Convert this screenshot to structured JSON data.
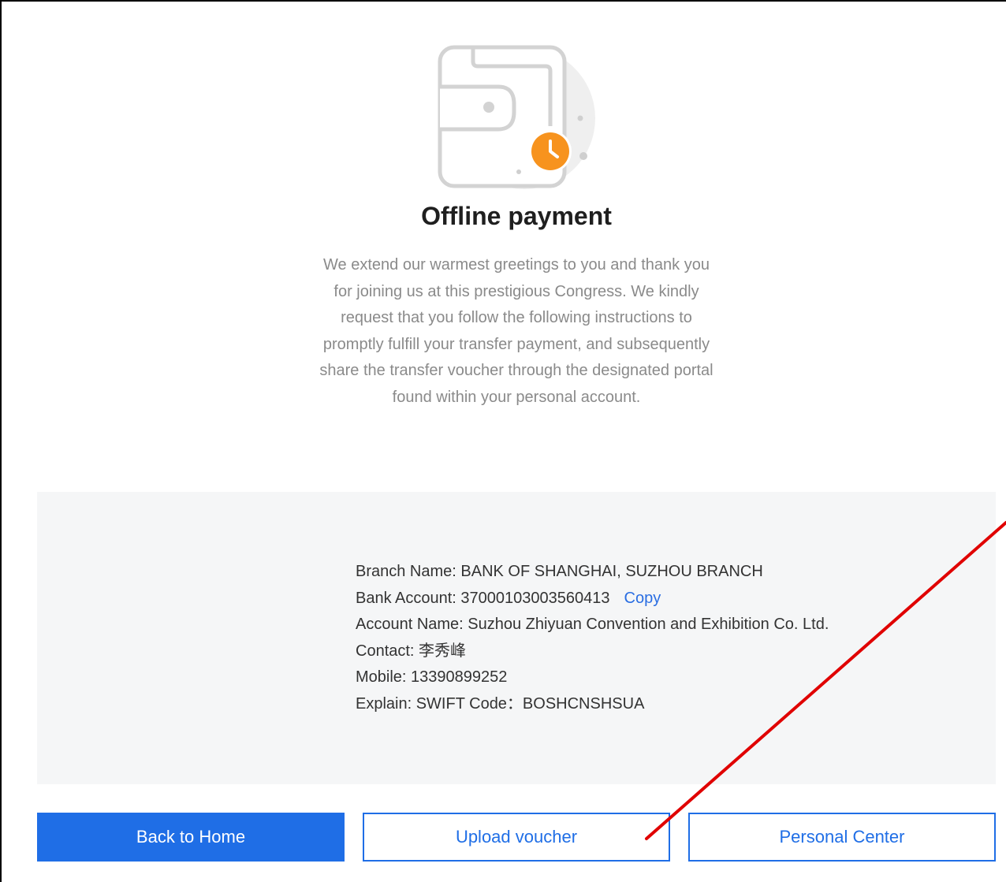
{
  "header": {
    "title": "Offline payment",
    "intro": "We extend our warmest greetings to you and thank you for joining us at this prestigious Congress. We kindly request that you follow the following instructions to promptly fulfill your transfer payment, and subsequently share the transfer voucher through the designated portal found within your personal account."
  },
  "bank_info": {
    "branch_label": "Branch Name: ",
    "branch_value": "BANK OF SHANGHAI, SUZHOU BRANCH",
    "account_label": "Bank Account: ",
    "account_value": "37000103003560413",
    "copy_label": "Copy",
    "account_name_label": "Account Name: ",
    "account_name_value": "Suzhou Zhiyuan Convention and Exhibition Co. Ltd.",
    "contact_label": "Contact: ",
    "contact_value": "李秀峰",
    "mobile_label": "Mobile: ",
    "mobile_value": "13390899252",
    "explain_label": "Explain: ",
    "explain_value": "SWIFT Code：BOSHCNSHSUA"
  },
  "actions": {
    "back_home": "Back to Home",
    "upload_voucher": "Upload voucher",
    "personal_center": "Personal Center"
  },
  "colors": {
    "primary": "#1f6ee6",
    "accent_orange": "#f7931e",
    "annotation_red": "#e00000",
    "panel_bg": "#f5f6f7"
  },
  "icons": {
    "main": "wallet-clock-icon",
    "badge": "clock-icon"
  }
}
